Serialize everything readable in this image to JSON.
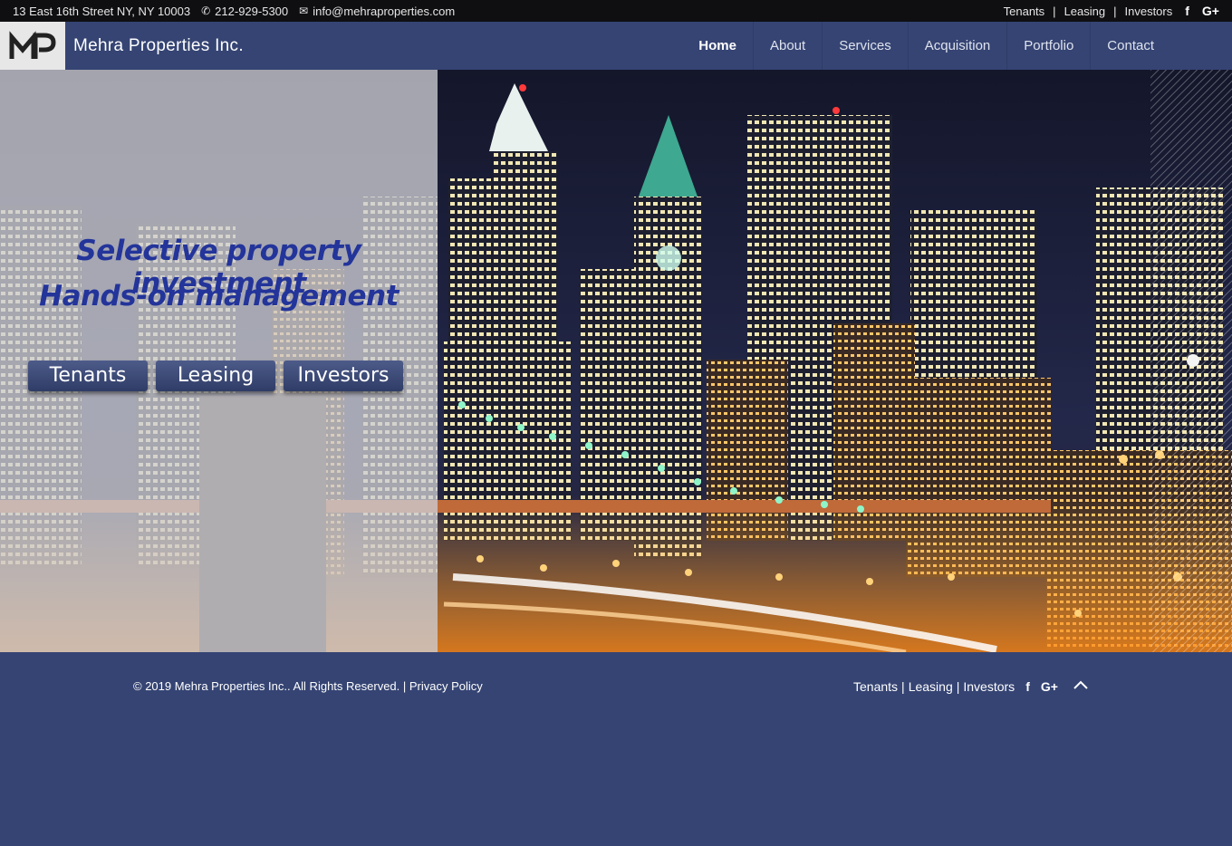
{
  "topbar": {
    "address": "13 East 16th Street NY, NY 10003",
    "phone": "212-929-5300",
    "email": "info@mehraproperties.com",
    "links": [
      "Tenants",
      "Leasing",
      "Investors"
    ],
    "social": [
      "f",
      "G+"
    ]
  },
  "header": {
    "logo_text": "MP",
    "brand": "Mehra Properties Inc.",
    "nav": [
      {
        "label": "Home",
        "active": true
      },
      {
        "label": "About",
        "active": false
      },
      {
        "label": "Services",
        "active": false
      },
      {
        "label": "Acquisition",
        "active": false
      },
      {
        "label": "Portfolio",
        "active": false
      },
      {
        "label": "Contact",
        "active": false
      }
    ]
  },
  "hero": {
    "headline_1": "Selective property investment",
    "headline_2": "Hands-on management",
    "buttons": [
      "Tenants",
      "Leasing",
      "Investors"
    ]
  },
  "footer": {
    "copyright": "© 2019 Mehra Properties Inc.. All Rights Reserved. |",
    "privacy": "Privacy Policy",
    "links": [
      "Tenants",
      "Leasing",
      "Investors"
    ],
    "social": [
      "f",
      "G+"
    ]
  },
  "colors": {
    "navy": "#354473",
    "topbar": "#0f0f12",
    "headline": "#23349a"
  },
  "icons": [
    "phone-icon",
    "mail-icon",
    "facebook-icon",
    "google-plus-icon",
    "chevron-up-icon"
  ]
}
